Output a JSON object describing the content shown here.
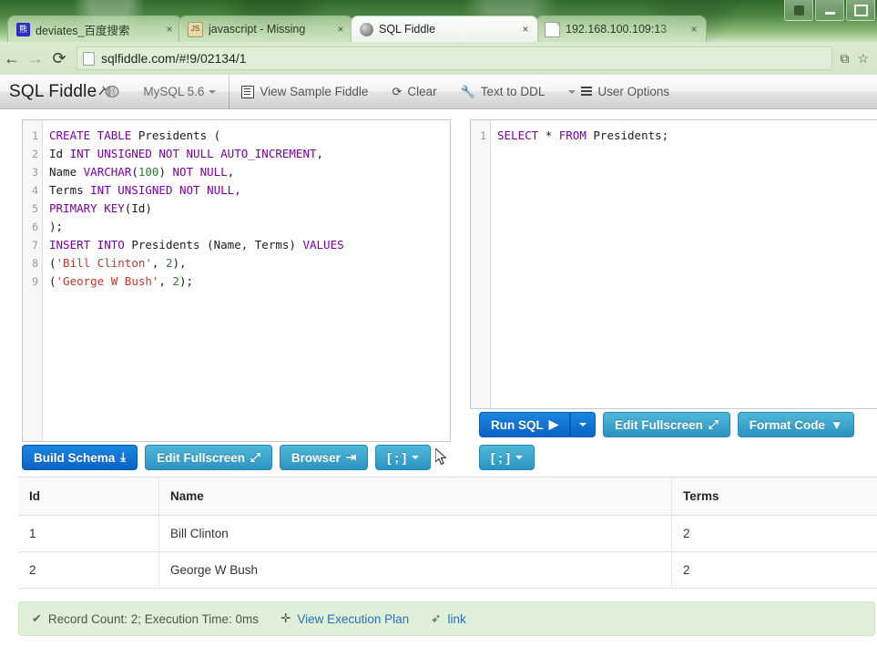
{
  "browser": {
    "tabs": [
      {
        "title": "deviates_百度搜索",
        "favicon": "baidu-icon",
        "active": false,
        "close_label": "×"
      },
      {
        "title": "javascript - Missing",
        "favicon": "javascript-icon",
        "active": false,
        "close_label": "×"
      },
      {
        "title": "SQL Fiddle",
        "favicon": "sql-fiddle-icon",
        "active": true,
        "close_label": "×"
      },
      {
        "title": "192.168.100.109:13",
        "favicon": "page-icon",
        "active": false,
        "close_label": "×"
      }
    ],
    "nav": {
      "back": "←",
      "forward": "→",
      "reload": "⟳"
    },
    "url": "sqlfiddle.com/#!9/02134/1",
    "omnibox_icons": [
      "copy-page-icon",
      "bookmark-star-icon"
    ],
    "window_controls": [
      "user-icon",
      "minimize-icon",
      "maximize-icon"
    ]
  },
  "toolbar": {
    "brand": "SQL Fiddle",
    "db_engine": "MySQL 5.6",
    "items": [
      {
        "label": "View Sample Fiddle",
        "icon": "list-icon"
      },
      {
        "label": "Clear",
        "icon": "refresh-icon"
      },
      {
        "label": "Text to DDL",
        "icon": "wrench-icon"
      },
      {
        "label": "User Options",
        "icon": "bars-icon"
      }
    ]
  },
  "schema_editor": {
    "lines": [
      {
        "n": "1",
        "tokens": [
          {
            "t": "CREATE TABLE ",
            "c": "kw"
          },
          {
            "t": "Presidents (",
            "c": "pun"
          }
        ]
      },
      {
        "n": "2",
        "tokens": [
          {
            "t": "Id ",
            "c": "pun"
          },
          {
            "t": "INT UNSIGNED NOT NULL AUTO_INCREMENT",
            "c": "kw"
          },
          {
            "t": ",",
            "c": "pun"
          }
        ]
      },
      {
        "n": "3",
        "tokens": [
          {
            "t": "Name ",
            "c": "pun"
          },
          {
            "t": "VARCHAR",
            "c": "kw"
          },
          {
            "t": "(",
            "c": "pun"
          },
          {
            "t": "100",
            "c": "num"
          },
          {
            "t": ") ",
            "c": "pun"
          },
          {
            "t": "NOT NULL",
            "c": "kw"
          },
          {
            "t": ",",
            "c": "pun"
          }
        ]
      },
      {
        "n": "4",
        "tokens": [
          {
            "t": "Terms ",
            "c": "pun"
          },
          {
            "t": "INT UNSIGNED NOT NULL",
            "c": "kw"
          },
          {
            "t": ",",
            "c": "pun"
          }
        ]
      },
      {
        "n": "5",
        "tokens": [
          {
            "t": "PRIMARY KEY",
            "c": "kw"
          },
          {
            "t": "(Id)",
            "c": "pun"
          }
        ]
      },
      {
        "n": "6",
        "tokens": [
          {
            "t": ");",
            "c": "pun"
          }
        ]
      },
      {
        "n": "7",
        "tokens": [
          {
            "t": "INSERT INTO ",
            "c": "kw"
          },
          {
            "t": "Presidents (Name, Terms) ",
            "c": "pun"
          },
          {
            "t": "VALUES",
            "c": "kw"
          }
        ]
      },
      {
        "n": "8",
        "tokens": [
          {
            "t": "(",
            "c": "pun"
          },
          {
            "t": "'Bill Clinton'",
            "c": "str"
          },
          {
            "t": ", ",
            "c": "pun"
          },
          {
            "t": "2",
            "c": "num"
          },
          {
            "t": "),",
            "c": "pun"
          }
        ]
      },
      {
        "n": "9",
        "tokens": [
          {
            "t": "(",
            "c": "pun"
          },
          {
            "t": "'George W Bush'",
            "c": "str"
          },
          {
            "t": ", ",
            "c": "pun"
          },
          {
            "t": "2",
            "c": "num"
          },
          {
            "t": ");",
            "c": "pun"
          }
        ]
      }
    ]
  },
  "query_editor": {
    "lines": [
      {
        "n": "1",
        "tokens": [
          {
            "t": "SELECT ",
            "c": "kw"
          },
          {
            "t": "* ",
            "c": "pun"
          },
          {
            "t": "FROM ",
            "c": "kw"
          },
          {
            "t": "Presidents;",
            "c": "pun"
          }
        ]
      }
    ]
  },
  "schema_buttons": [
    {
      "label": "Build Schema",
      "icon": "download-icon",
      "style": "primary"
    },
    {
      "label": "Edit Fullscreen",
      "icon": "expand-icon",
      "style": "info"
    },
    {
      "label": "Browser",
      "icon": "indent-icon",
      "style": "info"
    },
    {
      "label": "[ ; ]",
      "icon": "caret-down-icon",
      "style": "info"
    }
  ],
  "query_buttons": [
    {
      "label": "Run SQL",
      "icon": "play-icon",
      "style": "primary"
    },
    {
      "label": "Edit Fullscreen",
      "icon": "expand-icon",
      "style": "info"
    },
    {
      "label": "Format Code",
      "icon": "filter-icon",
      "style": "info"
    }
  ],
  "query_buttons_row2": [
    {
      "label": "[ ; ]",
      "icon": "caret-down-icon",
      "style": "info"
    }
  ],
  "results": {
    "columns": [
      "Id",
      "Name",
      "Terms"
    ],
    "rows": [
      [
        "1",
        "Bill Clinton",
        "2"
      ],
      [
        "2",
        "George W Bush",
        "2"
      ]
    ]
  },
  "status": {
    "message": "Record Count: 2; Execution Time: 0ms",
    "check_icon": "check-icon",
    "exec_plan_label": "View Execution Plan",
    "exec_plan_icon": "plus-icon",
    "link_label": "link",
    "link_icon": "arrow-icon"
  },
  "colors": {
    "primary": "#0a63c7",
    "info": "#2c93c2",
    "status_bg": "#dff0d8",
    "keyword": "#7b00a8",
    "string": "#c0392b",
    "number": "#2e7d32"
  }
}
